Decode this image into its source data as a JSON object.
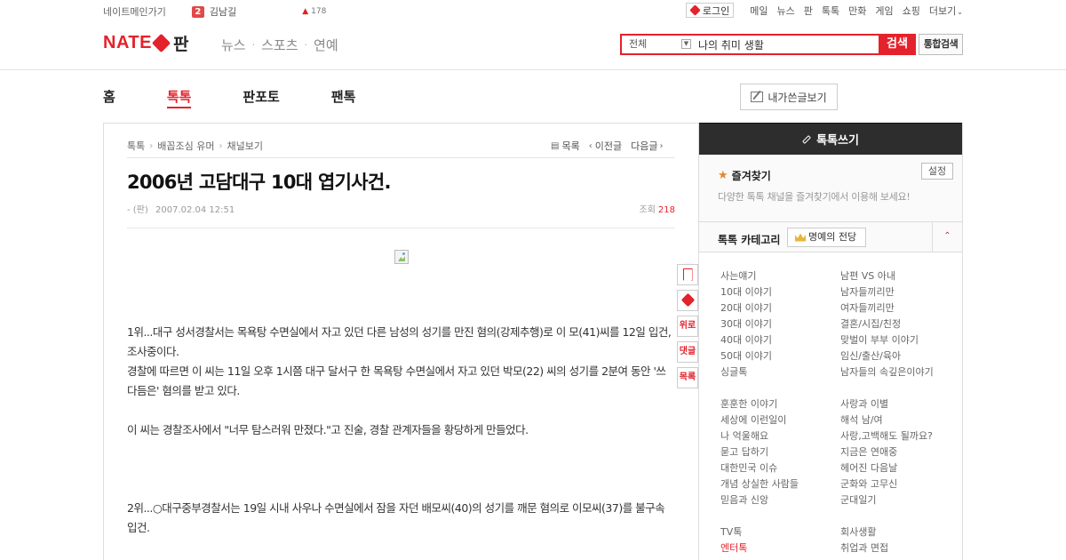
{
  "topbar": {
    "nate_main": "네이트메인가기",
    "badge": "2",
    "user": "김남길",
    "count": "178",
    "login": "로그인",
    "services": [
      "메일",
      "뉴스",
      "판",
      "톡톡",
      "만화",
      "게임",
      "쇼핑",
      "더보기"
    ]
  },
  "header": {
    "logo_text": "NATE",
    "logo_sub": "판",
    "gnb": [
      "뉴스",
      "스포츠",
      "연예"
    ],
    "search": {
      "scope": "전체",
      "value": "나의 취미 생활",
      "button": "검색",
      "unified": "통합검색"
    }
  },
  "menu": {
    "items": [
      "홈",
      "톡톡",
      "판포토",
      "팬톡"
    ],
    "active": "톡톡",
    "my_posts": "내가쓴글보기"
  },
  "article": {
    "breadcrumb": [
      "톡톡",
      "배꼽조심 유머",
      "채널보기"
    ],
    "nav": [
      "목록",
      "이전글",
      "다음글"
    ],
    "title": "2006년 고담대구 10대 엽기사건.",
    "author": "- (판)",
    "date": "2007.02.04 12:51",
    "views_label": "조회",
    "views": "218",
    "paragraphs": [
      "1위...대구 성서경찰서는 목욕탕 수면실에서 자고 있던 다른 남성의 성기를 만진 혐의(강제추행)로 이 모(41)씨를 12일 입건, 조사중이다.",
      "경찰에 따르면 이 씨는 11일 오후 1시쯤 대구 달서구 한 목욕탕 수면실에서 자고 있던 박모(22) 씨의 성기를 2분여 동안 '쓰다듬은' 혐의를 받고 있다.",
      "",
      "이 씨는 경찰조사에서 \"너무 탐스러워 만졌다.\"고 진술, 경찰 관계자들을 황당하게 만들었다.",
      "",
      "",
      "",
      "2위...○대구중부경찰서는 19일 시내 사우나 수면실에서 잠을 자던 배모씨(40)의 성기를 깨문 혐의로 이모씨(37)를 불구속 입건."
    ],
    "side_tools": [
      "위로",
      "댓글",
      "목록"
    ]
  },
  "sidebar": {
    "write": "톡톡쓰기",
    "fav_title": "즐겨찾기",
    "fav_setting": "설정",
    "fav_desc": "다양한 톡톡 채널을 즐겨찾기에서 이용해 보세요!",
    "cat_title": "톡톡 카테고리",
    "hall": "명예의 전당",
    "groups": [
      [
        [
          "사는얘기",
          "남편 VS 아내"
        ],
        [
          "10대 이야기",
          "남자들끼리만"
        ],
        [
          "20대 이야기",
          "여자들끼리만"
        ],
        [
          "30대 이야기",
          "결혼/시집/친정"
        ],
        [
          "40대 이야기",
          "맞벌이 부부 이야기"
        ],
        [
          "50대 이야기",
          "임신/출산/육아"
        ],
        [
          "싱글톡",
          "남자들의 속깊은이야기"
        ]
      ],
      [
        [
          "훈훈한 이야기",
          "사랑과 이별"
        ],
        [
          "세상에 이런일이",
          "해석 남/여"
        ],
        [
          "나 억울해요",
          "사랑,고백해도 될까요?"
        ],
        [
          "묻고 답하기",
          "지금은 연애중"
        ],
        [
          "대한민국 이슈",
          "헤어진 다음날"
        ],
        [
          "개념 상실한 사람들",
          "군화와 고무신"
        ],
        [
          "믿음과 신앙",
          "군대일기"
        ]
      ],
      [
        [
          "TV톡",
          "회사생활"
        ],
        [
          "엔터톡",
          "취업과 면접"
        ]
      ]
    ]
  },
  "colors": {
    "brand": "#e4222c",
    "sidebar_dark": "#2d2d2d"
  }
}
